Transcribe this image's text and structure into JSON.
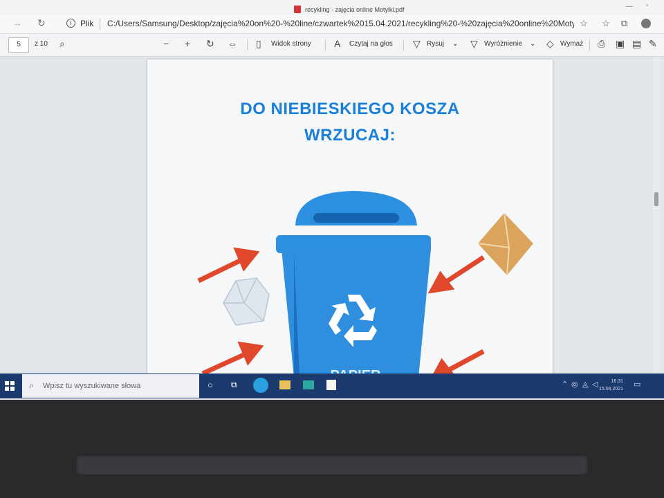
{
  "browser": {
    "tab_title": "recykling - zajęcia online Motylki.pdf",
    "security_label": "Plik",
    "url": "C:/Users/Samsung/Desktop/zajęcia%20on%20-%20line/czwartek%2015.04.2021/recykling%20-%20zajęcia%20online%20Moty..."
  },
  "pdf_toolbar": {
    "page_number": "5",
    "page_total": "z 10",
    "page_view": "Widok strony",
    "read_aloud": "Czytaj na głos",
    "draw": "Rysuj",
    "highlight": "Wyróżnienie",
    "erase": "Wymaż"
  },
  "document": {
    "heading_line1": "DO NIEBIESKIEGO KOSZA",
    "heading_line2": "WRZUCAJ:",
    "bin_label": "PAPIER"
  },
  "taskbar": {
    "search_placeholder": "Wpisz tu wyszukiwane słowa",
    "time": "16:31",
    "date": "15.04.2021"
  },
  "colors": {
    "heading": "#1a7fd8",
    "bin": "#2d8fe0",
    "arrow": "#e0482b",
    "envelope": "#d9a05b",
    "taskbar": "#1b3a6e"
  }
}
